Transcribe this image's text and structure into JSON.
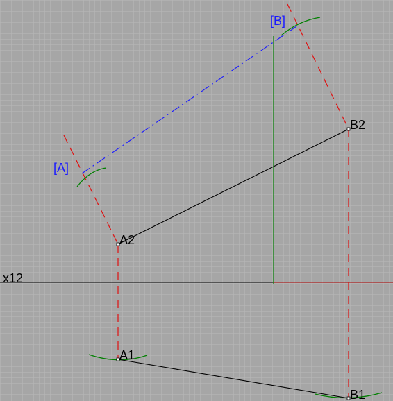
{
  "drawing": {
    "axis_label": "x12",
    "points": {
      "A1": "A1",
      "A2": "A2",
      "B1": "B1",
      "B2": "B2",
      "A_true": "[A]",
      "B_true": "[B]"
    }
  },
  "colors": {
    "background": "#a6a6a6",
    "grid": "#b9b9b9",
    "object_line": "#000000",
    "construction_line": "#e01010",
    "true_length_line": "#1a1aff",
    "arc": "#008000",
    "axis": "#000000",
    "auxiliary_axis": "#008000",
    "label_projection": "#000000",
    "label_true": "#1a1aff"
  }
}
